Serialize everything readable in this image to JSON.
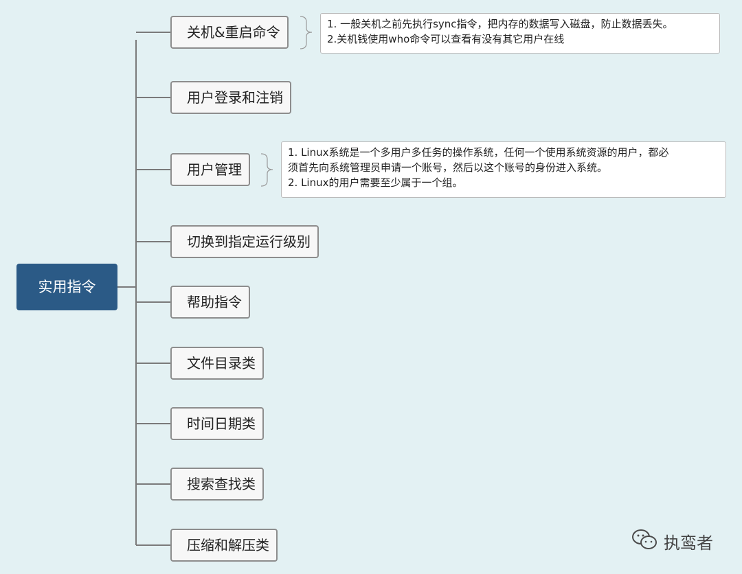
{
  "mindmap": {
    "root": {
      "label": "实用指令"
    },
    "branches": [
      {
        "label": "关机&重启命令"
      },
      {
        "label": "用户登录和注销"
      },
      {
        "label": "用户管理"
      },
      {
        "label": "切换到指定运行级别"
      },
      {
        "label": "帮助指令"
      },
      {
        "label": "文件目录类"
      },
      {
        "label": "时间日期类"
      },
      {
        "label": "搜索查找类"
      },
      {
        "label": "压缩和解压类"
      }
    ],
    "notes": [
      {
        "branch": "关机&重启命令",
        "lines": [
          "1. 一般关机之前先执行sync指令，把内存的数据写入磁盘，防止数据丢失。",
          "2.关机钱使用who命令可以查看有没有其它用户在线"
        ]
      },
      {
        "branch": "用户管理",
        "lines": [
          "1. Linux系统是一个多用户多任务的操作系统，任何一个使用系统资源的用户，都必",
          "须首先向系统管理员申请一个账号，然后以这个账号的身份进入系统。",
          "2. Linux的用户需要至少属于一个组。"
        ]
      }
    ]
  },
  "watermark": {
    "icon": "wechat-icon",
    "text": "执鸾者"
  },
  "colors": {
    "background": "#e3f1f3",
    "root_fill": "#2b5a86",
    "connector": "#7a7a7a",
    "node_border": "#8d8d8d"
  }
}
